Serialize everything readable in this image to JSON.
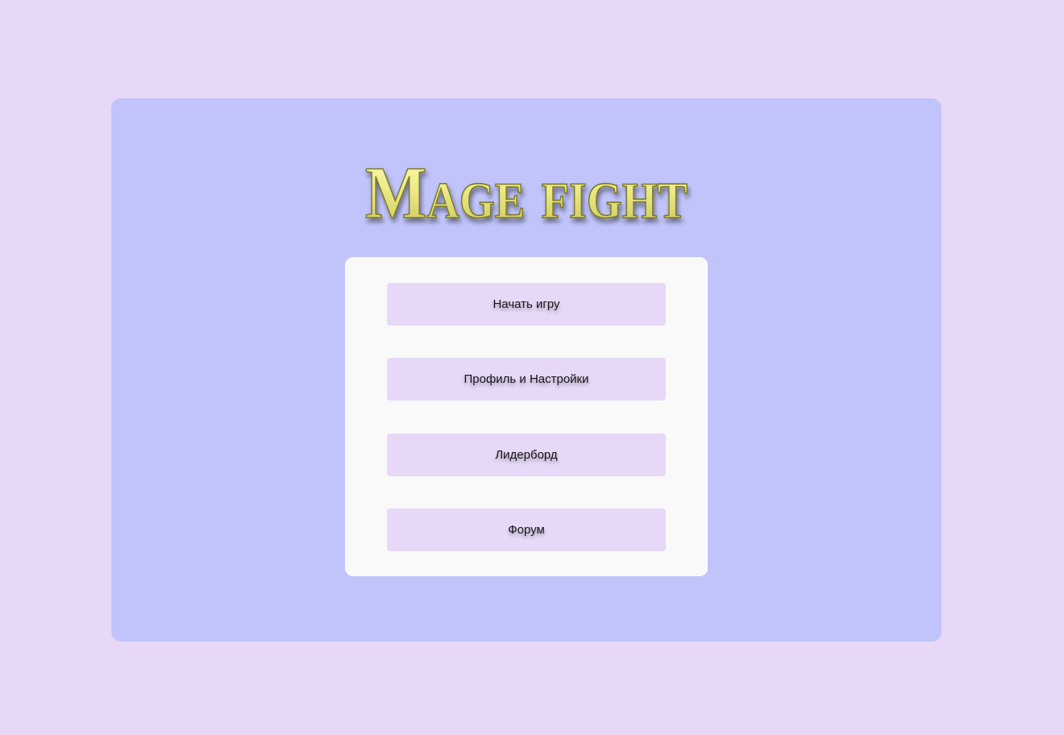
{
  "logo": {
    "text": "Mage fight",
    "colors": {
      "fill": "#e6e37a",
      "highlight": "#fffbb0",
      "stroke": "#7c7a24"
    }
  },
  "menu": {
    "buttons": [
      {
        "label": "Начать игру"
      },
      {
        "label": "Профиль и Настройки"
      },
      {
        "label": "Лидерборд"
      },
      {
        "label": "Форум"
      }
    ]
  },
  "colors": {
    "page_background": "#e7d8f8",
    "panel_background": "#c0c4fa",
    "menu_background": "#f9f9fa",
    "button_background": "#e6d8f6",
    "button_text": "#151515"
  }
}
